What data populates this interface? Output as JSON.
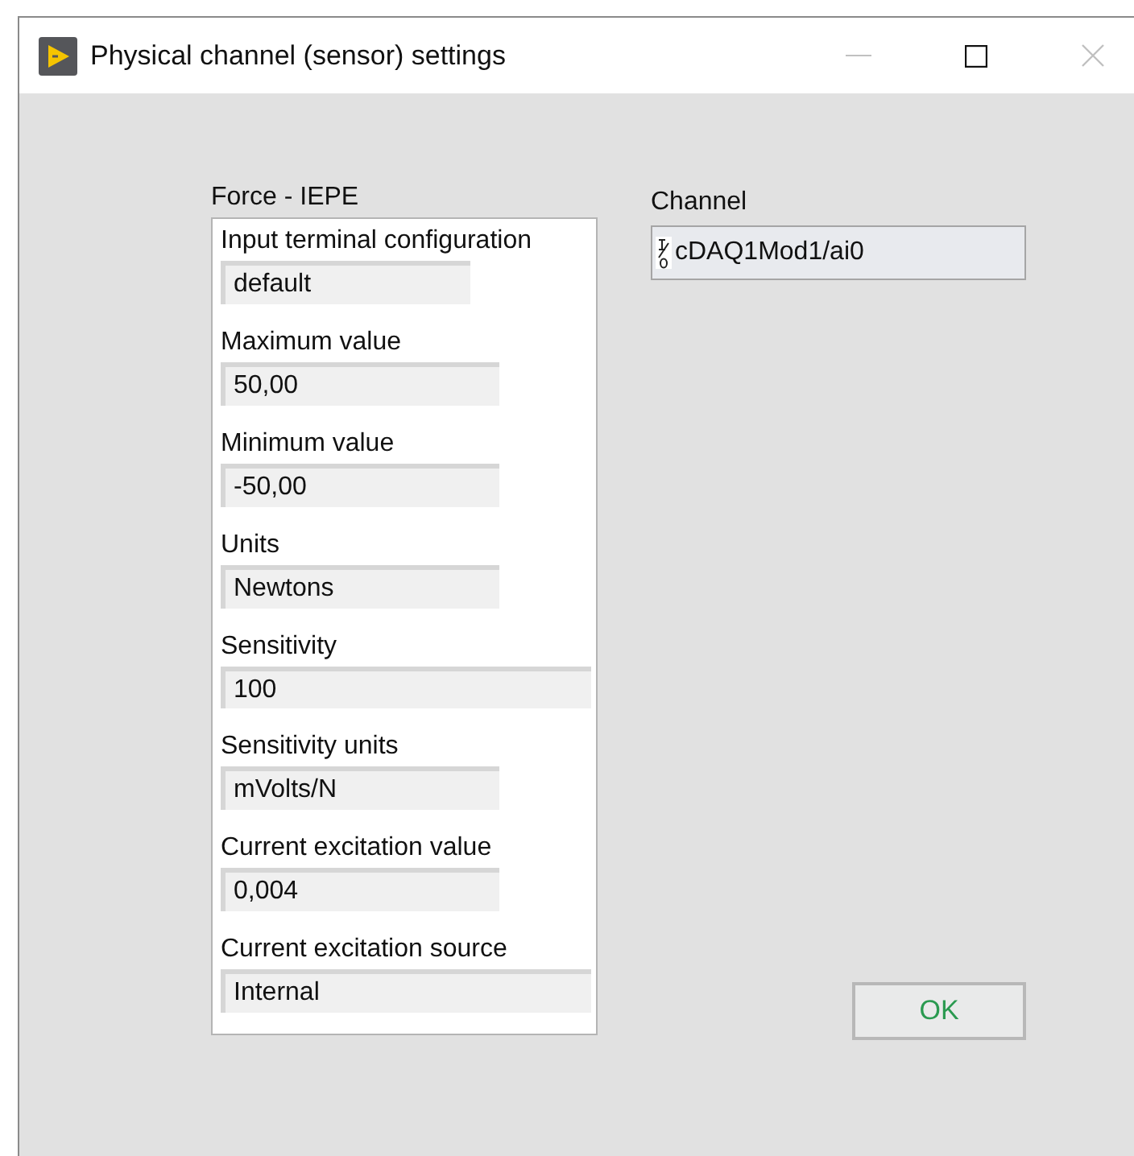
{
  "window": {
    "title": "Physical channel (sensor) settings"
  },
  "sensor_panel": {
    "title": "Force - IEPE",
    "fields": [
      {
        "label": "Input terminal configuration",
        "value": "default"
      },
      {
        "label": "Maximum value",
        "value": "50,00"
      },
      {
        "label": "Minimum value",
        "value": "-50,00"
      },
      {
        "label": "Units",
        "value": "Newtons"
      },
      {
        "label": "Sensitivity",
        "value": "100"
      },
      {
        "label": "Sensitivity units",
        "value": "mVolts/N"
      },
      {
        "label": "Current excitation value",
        "value": "0,004"
      },
      {
        "label": "Current excitation source",
        "value": "Internal"
      }
    ]
  },
  "channel": {
    "label": "Channel",
    "value": "cDAQ1Mod1/ai0"
  },
  "buttons": [
    {
      "label": "OK"
    }
  ]
}
